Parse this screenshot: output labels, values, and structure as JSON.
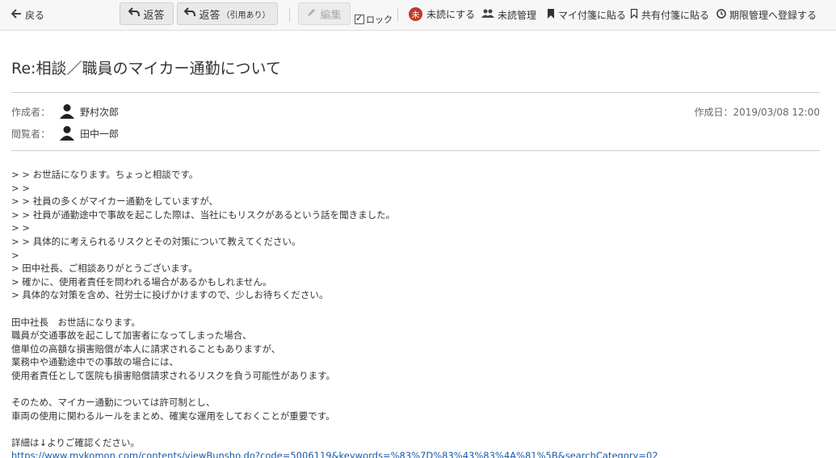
{
  "toolbar": {
    "back_label": "戻る",
    "reply_label": "返答",
    "reply_quote_label": "返答",
    "reply_quote_suffix": "（引用あり）",
    "edit_label": "編集",
    "lock_label": "ロック",
    "unread_badge": "未",
    "mark_unread_label": "未読にする",
    "unread_manage_label": "未読管理",
    "my_sticky_label": "マイ付箋に貼る",
    "shared_sticky_label": "共有付箋に貼る",
    "deadline_label": "期限管理へ登録する"
  },
  "message": {
    "title": "Re:相談／職員のマイカー通勤について",
    "author_label": "作成者：",
    "author_name": "野村次郎",
    "viewer_label": "閲覧者：",
    "viewer_name": "田中一郎",
    "created": "作成日：2019/03/08 12:00",
    "body_lines": [
      "> > お世話になります。ちょっと相談です。",
      "> >",
      "> > 社員の多くがマイカー通勤をしていますが、",
      "> > 社員が通勤途中で事故を起こした際は、当社にもリスクがあるという話を聞きました。",
      "> >",
      "> > 具体的に考えられるリスクとその対策について教えてください。",
      ">",
      "> 田中社長、ご相談ありがとうございます。",
      "> 確かに、使用者責任を問われる場合があるかもしれません。",
      "> 具体的な対策を含め、社労士に投げかけますので、少しお待ちください。",
      "",
      "田中社長　お世話になります。",
      "職員が交通事故を起こして加害者になってしまった場合、",
      "億単位の高額な損害賠償が本人に請求されることもありますが、",
      "業務中や通勤途中での事故の場合には、",
      "使用者責任として医院も損害賠償請求されるリスクを負う可能性があります。",
      "",
      "そのため、マイカー通勤については許可制とし、",
      "車両の使用に関わるルールをまとめ、確実な運用をしておくことが重要です。",
      "",
      "詳細は↓よりご確認ください。"
    ],
    "link": "https://www.mykomon.com/contents/viewBunsho.do?code=5006119&keywords=%83%7D%83%43%83%4A%81%5B&searchCategory=02"
  }
}
